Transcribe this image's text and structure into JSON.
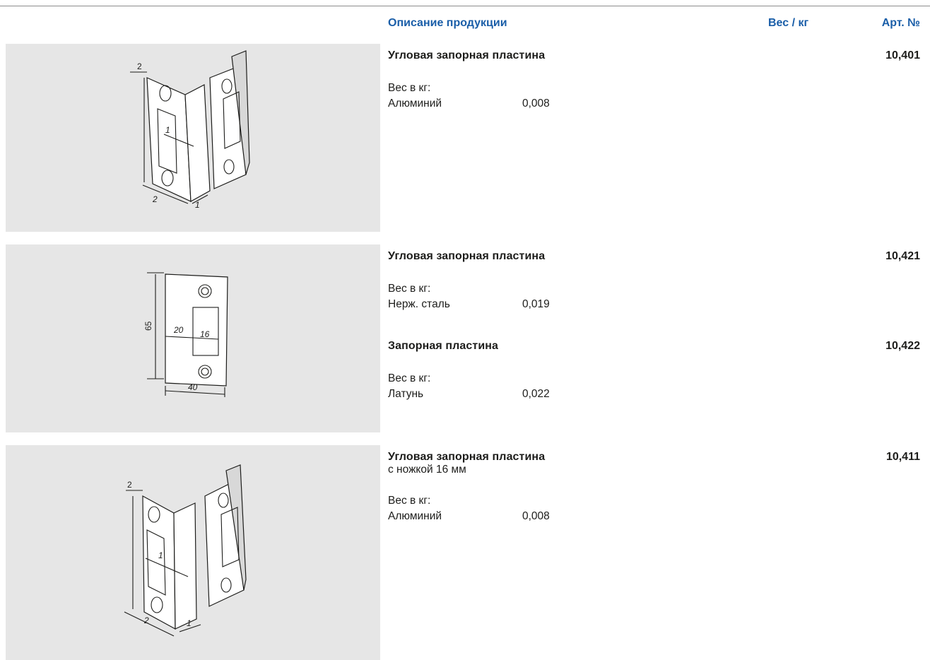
{
  "header": {
    "description": "Описание продукции",
    "weight": "Вес / кг",
    "article": "Арт. №"
  },
  "products": [
    {
      "title": "Угловая запорная пластина",
      "subtitle": "",
      "article": "10,401",
      "weight_label": "Вес в кг:",
      "material": "Алюминий",
      "weight": "0,008",
      "drawing": {
        "dim_a": "2",
        "dim_b": "1",
        "dim_c": "2",
        "dim_d": "1"
      }
    },
    {
      "title": "Угловая запорная пластина",
      "subtitle": "",
      "article": "10,421",
      "weight_label": "Вес в кг:",
      "material": "Нерж. сталь",
      "weight": "0,019",
      "drawing": {
        "height": "65",
        "inner": "20",
        "slot": "16",
        "width": "40"
      }
    },
    {
      "title": "Запорная пластина",
      "subtitle": "",
      "article": "10,422",
      "weight_label": "Вес в кг:",
      "material": "Латунь",
      "weight": "0,022"
    },
    {
      "title": "Угловая запорная пластина",
      "subtitle": "с ножкой 16 мм",
      "article": "10,411",
      "weight_label": "Вес в кг:",
      "material": "Алюминий",
      "weight": "0,008",
      "drawing": {
        "dim_a": "2",
        "dim_b": "1",
        "dim_c": "2",
        "dim_d": "1"
      }
    }
  ]
}
